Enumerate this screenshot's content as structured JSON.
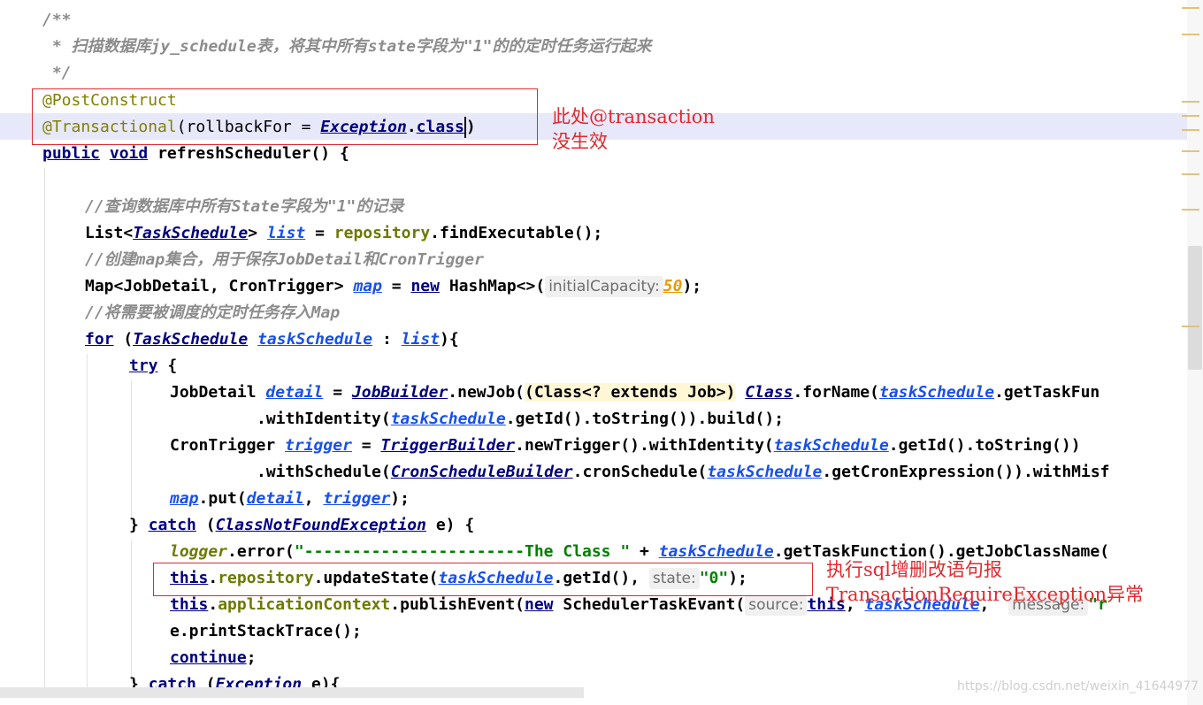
{
  "editor": {
    "lines": {
      "c1": "/**",
      "c2": " * 扫描数据库jy_schedule表，将其中所有state字段为\"1\"的的定时任务运行起来",
      "c3": " */",
      "l4_ann": "@PostConstruct",
      "l5_ann": "@Transactional",
      "l5_rest1": "(rollbackFor = ",
      "l5_cls": "Exception",
      "l5_dot": ".",
      "l5_kw": "class",
      "l5_end": ")",
      "l6_kw1": "public",
      "l6_kw2": "void",
      "l6_rest": " refreshScheduler() {",
      "c8": "//查询数据库中所有State字段为\"1\"的记录",
      "l9_a": "List<",
      "l9_cls": "TaskSchedule",
      "l9_b": "> ",
      "l9_var": "list",
      "l9_c": " = ",
      "l9_fld": "repository",
      "l9_d": ".findExecutable();",
      "c10": "//创建map集合，用于保存JobDetail和CronTrigger",
      "l11_a": "Map<JobDetail, CronTrigger> ",
      "l11_var": "map",
      "l11_b": " = ",
      "l11_kw": "new",
      "l11_c": " HashMap<>(",
      "l11_hint": "initialCapacity:",
      "l11_num": "50",
      "l11_d": ");",
      "c12": "//将需要被调度的定时任务存入Map",
      "l13_kw": "for",
      "l13_a": " (",
      "l13_cls": "TaskSchedule",
      "l13_b": " ",
      "l13_var": "taskSchedule",
      "l13_c": " : ",
      "l13_var2": "list",
      "l13_d": "){",
      "l14_kw": "try",
      "l14_a": " {",
      "l15_a": "JobDetail ",
      "l15_var": "detail",
      "l15_b": " = ",
      "l15_cls": "JobBuilder",
      "l15_c": ".newJob(",
      "l15_hl": "(Class<? extends Job>)",
      "l15_d": " ",
      "l15_cls2": "Class",
      "l15_e": ".forName(",
      "l15_var2": "taskSchedule",
      "l15_f": ".getTaskFun",
      "l16_a": ".withIdentity(",
      "l16_var": "taskSchedule",
      "l16_b": ".getId().toString()).build();",
      "l17_a": "CronTrigger ",
      "l17_var": "trigger",
      "l17_b": " = ",
      "l17_cls": "TriggerBuilder",
      "l17_c": ".newTrigger().withIdentity(",
      "l17_var2": "taskSchedule",
      "l17_d": ".getId().toString())",
      "l18_a": ".withSchedule(",
      "l18_cls": "CronScheduleBuilder",
      "l18_b": ".cronSchedule(",
      "l18_var": "taskSchedule",
      "l18_c": ".getCronExpression()).withMisf",
      "l19_var": "map",
      "l19_a": ".put(",
      "l19_var2": "detail",
      "l19_b": ", ",
      "l19_var3": "trigger",
      "l19_c": ");",
      "l20_a": "} ",
      "l20_kw": "catch",
      "l20_b": " (",
      "l20_cls": "ClassNotFoundException",
      "l20_c": " e) {",
      "l21_fld": "logger",
      "l21_a": ".error(",
      "l21_str": "\"-----------------------The Class \"",
      "l21_b": " + ",
      "l21_var": "taskSchedule",
      "l21_c": ".getTaskFunction().getJobClassName(",
      "l22_kw": "this",
      "l22_a": ".",
      "l22_fld": "repository",
      "l22_b": ".updateState(",
      "l22_var": "taskSchedule",
      "l22_c": ".getId(), ",
      "l22_hint": "state:",
      "l22_str": "\"0\"",
      "l22_d": ");",
      "l23_kw": "this",
      "l23_a": ".",
      "l23_fld": "applicationContext",
      "l23_b": ".publishEvent(",
      "l23_kw2": "new",
      "l23_c": " SchedulerTaskEvant(",
      "l23_hint": "source:",
      "l23_kw3": "this",
      "l23_d": ", ",
      "l23_var": "taskSchedule",
      "l23_e": ",  ",
      "l23_hint2": "message:",
      "l23_str": "\"r",
      "l24": "e.printStackTrace();",
      "l25_kw": "continue",
      "l25_a": ";",
      "l26_a": "} ",
      "l26_kw": "catch",
      "l26_b": " (",
      "l26_cls": "Exception",
      "l26_c": " e){"
    }
  },
  "annotations": {
    "note1": "此处@transaction\n没生效",
    "note2": "执行sql增删改语句报\nTransactionRequireException异常"
  },
  "watermark": "https://blog.csdn.net/weixin_41644977"
}
